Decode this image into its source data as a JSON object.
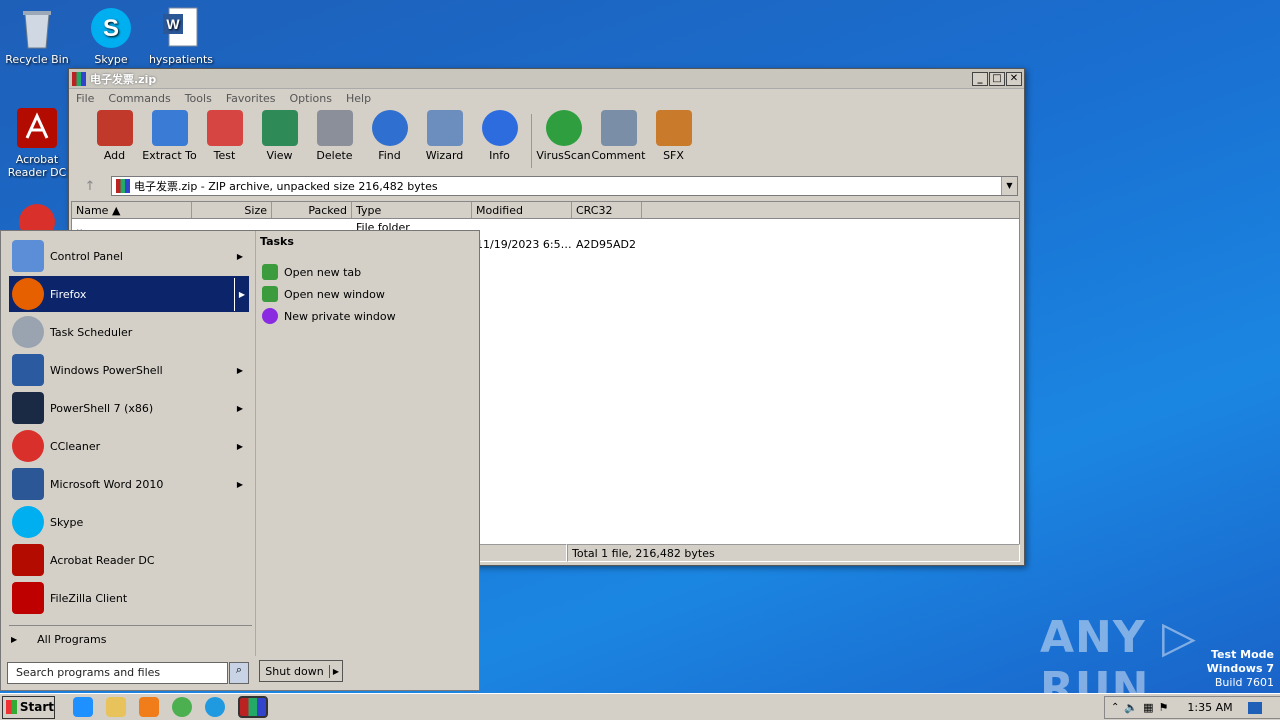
{
  "desktop": {
    "icons": [
      {
        "label": "Recycle Bin",
        "icon": "recycle-bin-icon"
      },
      {
        "label": "Skype",
        "icon": "skype-icon"
      },
      {
        "label": "hyspatients",
        "icon": "word-doc-icon"
      },
      {
        "label": "Acrobat Reader DC",
        "icon": "acrobat-icon"
      }
    ]
  },
  "window": {
    "title": "电子发票.zip",
    "menu": [
      "File",
      "Commands",
      "Tools",
      "Favorites",
      "Options",
      "Help"
    ],
    "toolbar": [
      {
        "label": "Add",
        "color": "#c0392b"
      },
      {
        "label": "Extract To",
        "color": "#3a7bd5"
      },
      {
        "label": "Test",
        "color": "#d64541"
      },
      {
        "label": "View",
        "color": "#2e8b57"
      },
      {
        "label": "Delete",
        "color": "#8a8f99"
      },
      {
        "label": "Find",
        "color": "#2f6fd0"
      },
      {
        "label": "Wizard",
        "color": "#6c8ebf"
      },
      {
        "label": "Info",
        "color": "#2d6cdf"
      },
      {
        "label": "VirusScan",
        "color": "#2e9e3e"
      },
      {
        "label": "Comment",
        "color": "#7a8ea8"
      },
      {
        "label": "SFX",
        "color": "#c97b2b"
      }
    ],
    "address": "电子发票.zip - ZIP archive, unpacked size 216,482 bytes",
    "columns": [
      "Name",
      "Size",
      "Packed",
      "Type",
      "Modified",
      "CRC32"
    ],
    "rows": [
      {
        "name": "..",
        "size": "",
        "packed": "",
        "type": "File folder",
        "modified": "",
        "crc": ""
      },
      {
        "name": "",
        "size": "",
        "packed": "",
        "type": "",
        "modified": "11/19/2023 6:5…",
        "crc": "A2D95AD2"
      }
    ],
    "status": "Total 1 file, 216,482 bytes"
  },
  "startmenu": {
    "items": [
      {
        "label": "Control Panel",
        "arrow": true,
        "color": "#5b8ed6"
      },
      {
        "label": "Firefox",
        "arrow": true,
        "color": "#e66000"
      },
      {
        "label": "Task Scheduler",
        "arrow": false,
        "color": "#9aa4b0"
      },
      {
        "label": "Windows PowerShell",
        "arrow": true,
        "color": "#2c5aa0"
      },
      {
        "label": "PowerShell 7 (x86)",
        "arrow": true,
        "color": "#1b2a44"
      },
      {
        "label": "CCleaner",
        "arrow": true,
        "color": "#d9302c"
      },
      {
        "label": "Microsoft Word 2010",
        "arrow": true,
        "color": "#2b5797"
      },
      {
        "label": "Skype",
        "arrow": false,
        "color": "#00aff0"
      },
      {
        "label": "Acrobat Reader DC",
        "arrow": false,
        "color": "#b30b00"
      },
      {
        "label": "FileZilla Client",
        "arrow": false,
        "color": "#bf0000"
      }
    ],
    "all_programs": "All Programs",
    "tasks_title": "Tasks",
    "tasks": [
      {
        "label": "Open new tab",
        "color": "#3c9b3c"
      },
      {
        "label": "Open new window",
        "color": "#3c9b3c"
      },
      {
        "label": "New private window",
        "color": "#8a2be2"
      }
    ],
    "search_placeholder": "Search programs and files",
    "shutdown": "Shut down"
  },
  "taskbar": {
    "start": "Start",
    "time": "1:35 AM"
  },
  "watermark": {
    "line1": "Test Mode",
    "line2": "Windows 7",
    "line3": "Build 7601",
    "brand": "ANY ▷ RUN"
  }
}
